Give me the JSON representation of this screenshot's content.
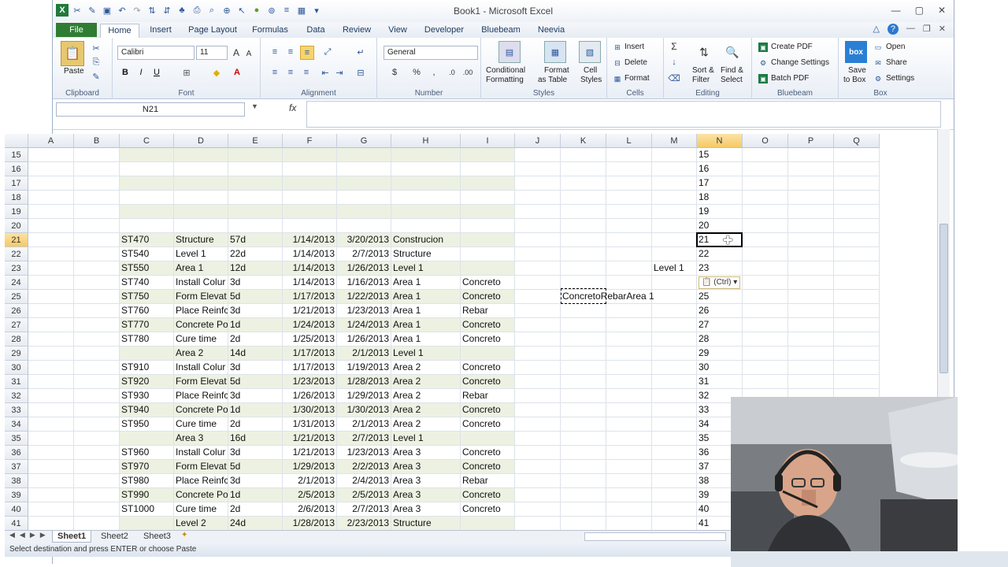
{
  "window": {
    "title": "Book1 - Microsoft Excel"
  },
  "tabs": [
    "Home",
    "Insert",
    "Page Layout",
    "Formulas",
    "Data",
    "Review",
    "View",
    "Developer",
    "Bluebeam",
    "Neevia"
  ],
  "file_tab": "File",
  "ribbon": {
    "clipboard": {
      "label": "Clipboard",
      "paste": "Paste"
    },
    "font": {
      "label": "Font",
      "name": "Calibri",
      "size": "11"
    },
    "alignment": {
      "label": "Alignment"
    },
    "number": {
      "label": "Number",
      "format": "General"
    },
    "styles": {
      "label": "Styles",
      "conditional": "Conditional",
      "conditional2": "Formatting",
      "format_table": "Format",
      "format_table2": "as Table",
      "cell_styles": "Cell",
      "cell_styles2": "Styles"
    },
    "cells": {
      "label": "Cells",
      "insert": "Insert",
      "delete": "Delete",
      "format": "Format"
    },
    "editing": {
      "label": "Editing",
      "sort": "Sort &",
      "sort2": "Filter",
      "find": "Find &",
      "find2": "Select"
    },
    "bluebeam": {
      "label": "Bluebeam",
      "create_pdf": "Create PDF",
      "change_settings": "Change Settings",
      "batch_pdf": "Batch PDF"
    },
    "box": {
      "label": "Box",
      "save": "Save",
      "save2": "to Box",
      "open": "Open",
      "share": "Share",
      "settings": "Settings"
    }
  },
  "formula_bar": {
    "name_box": "N21",
    "fx": "fx",
    "formula": ""
  },
  "columns": [
    "A",
    "B",
    "C",
    "D",
    "E",
    "F",
    "G",
    "H",
    "I",
    "J",
    "K",
    "L",
    "M",
    "N",
    "O",
    "P",
    "Q"
  ],
  "selected_column": "N",
  "rows": [
    {
      "n": "15",
      "band": true,
      "c": "",
      "d": "",
      "e": "",
      "f": "",
      "g": "",
      "h": "",
      "i": ""
    },
    {
      "n": "16",
      "band": false,
      "c": "",
      "d": "",
      "e": "",
      "f": "",
      "g": "",
      "h": "",
      "i": ""
    },
    {
      "n": "17",
      "band": true,
      "c": "",
      "d": "",
      "e": "",
      "f": "",
      "g": "",
      "h": "",
      "i": ""
    },
    {
      "n": "18",
      "band": false,
      "c": "",
      "d": "",
      "e": "",
      "f": "",
      "g": "",
      "h": "",
      "i": ""
    },
    {
      "n": "19",
      "band": true,
      "c": "",
      "d": "",
      "e": "",
      "f": "",
      "g": "",
      "h": "",
      "i": ""
    },
    {
      "n": "20",
      "band": false,
      "c": "",
      "d": "",
      "e": "",
      "f": "",
      "g": "",
      "h": "",
      "i": ""
    },
    {
      "n": "21",
      "band": true,
      "c": "ST470",
      "d": "Structure",
      "e": "57d",
      "f": "1/14/2013",
      "g": "3/20/2013",
      "h": "Construcion",
      "i": ""
    },
    {
      "n": "22",
      "band": false,
      "c": "ST540",
      "d": "Level 1",
      "e": "22d",
      "f": "1/14/2013",
      "g": "2/7/2013",
      "h": "Structure",
      "i": ""
    },
    {
      "n": "23",
      "band": true,
      "c": "ST550",
      "d": "Area 1",
      "e": "12d",
      "f": "1/14/2013",
      "g": "1/26/2013",
      "h": "Level 1",
      "i": ""
    },
    {
      "n": "24",
      "band": false,
      "c": "ST740",
      "d": "Install Colur",
      "e": "3d",
      "f": "1/14/2013",
      "g": "1/16/2013",
      "h": "Area 1",
      "i": "Concreto"
    },
    {
      "n": "25",
      "band": true,
      "c": "ST750",
      "d": "Form Elevat",
      "e": "5d",
      "f": "1/17/2013",
      "g": "1/22/2013",
      "h": "Area 1",
      "i": "Concreto"
    },
    {
      "n": "26",
      "band": false,
      "c": "ST760",
      "d": "Place Reinfc",
      "e": "3d",
      "f": "1/21/2013",
      "g": "1/23/2013",
      "h": "Area 1",
      "i": "Rebar"
    },
    {
      "n": "27",
      "band": true,
      "c": "ST770",
      "d": "Concrete Po",
      "e": "1d",
      "f": "1/24/2013",
      "g": "1/24/2013",
      "h": "Area 1",
      "i": "Concreto"
    },
    {
      "n": "28",
      "band": false,
      "c": "ST780",
      "d": "Cure time",
      "e": "2d",
      "f": "1/25/2013",
      "g": "1/26/2013",
      "h": "Area 1",
      "i": "Concreto"
    },
    {
      "n": "29",
      "band": true,
      "c": "",
      "d": "Area 2",
      "e": "14d",
      "f": "1/17/2013",
      "g": "2/1/2013",
      "h": "Level 1",
      "i": ""
    },
    {
      "n": "30",
      "band": false,
      "c": "ST910",
      "d": "Install Colur",
      "e": "3d",
      "f": "1/17/2013",
      "g": "1/19/2013",
      "h": "Area 2",
      "i": "Concreto"
    },
    {
      "n": "31",
      "band": true,
      "c": "ST920",
      "d": "Form Elevat",
      "e": "5d",
      "f": "1/23/2013",
      "g": "1/28/2013",
      "h": "Area 2",
      "i": "Concreto"
    },
    {
      "n": "32",
      "band": false,
      "c": "ST930",
      "d": "Place Reinfc",
      "e": "3d",
      "f": "1/26/2013",
      "g": "1/29/2013",
      "h": "Area 2",
      "i": "Rebar"
    },
    {
      "n": "33",
      "band": true,
      "c": "ST940",
      "d": "Concrete Po",
      "e": "1d",
      "f": "1/30/2013",
      "g": "1/30/2013",
      "h": "Area 2",
      "i": "Concreto"
    },
    {
      "n": "34",
      "band": false,
      "c": "ST950",
      "d": "Cure time",
      "e": "2d",
      "f": "1/31/2013",
      "g": "2/1/2013",
      "h": "Area 2",
      "i": "Concreto"
    },
    {
      "n": "35",
      "band": true,
      "c": "",
      "d": "Area 3",
      "e": "16d",
      "f": "1/21/2013",
      "g": "2/7/2013",
      "h": "Level 1",
      "i": ""
    },
    {
      "n": "36",
      "band": false,
      "c": "ST960",
      "d": "Install Colur",
      "e": "3d",
      "f": "1/21/2013",
      "g": "1/23/2013",
      "h": "Area 3",
      "i": "Concreto"
    },
    {
      "n": "37",
      "band": true,
      "c": "ST970",
      "d": "Form Elevat",
      "e": "5d",
      "f": "1/29/2013",
      "g": "2/2/2013",
      "h": "Area 3",
      "i": "Concreto"
    },
    {
      "n": "38",
      "band": false,
      "c": "ST980",
      "d": "Place Reinfc",
      "e": "3d",
      "f": "2/1/2013",
      "g": "2/4/2013",
      "h": "Area 3",
      "i": "Rebar"
    },
    {
      "n": "39",
      "band": true,
      "c": "ST990",
      "d": "Concrete Po",
      "e": "1d",
      "f": "2/5/2013",
      "g": "2/5/2013",
      "h": "Area 3",
      "i": "Concreto"
    },
    {
      "n": "40",
      "band": false,
      "c": "ST1000",
      "d": "Cure time",
      "e": "2d",
      "f": "2/6/2013",
      "g": "2/7/2013",
      "h": "Area 3",
      "i": "Concreto"
    },
    {
      "n": "41",
      "band": true,
      "c": "",
      "d": "Level 2",
      "e": "24d",
      "f": "1/28/2013",
      "g": "2/23/2013",
      "h": "Structure",
      "i": ""
    }
  ],
  "extra_cells": {
    "m23": "Level 1",
    "k25": "ConcretoRebarArea 1"
  },
  "paste_tag": "(Ctrl)",
  "sheets": [
    "Sheet1",
    "Sheet2",
    "Sheet3"
  ],
  "status": "Select destination and press ENTER or choose Paste"
}
